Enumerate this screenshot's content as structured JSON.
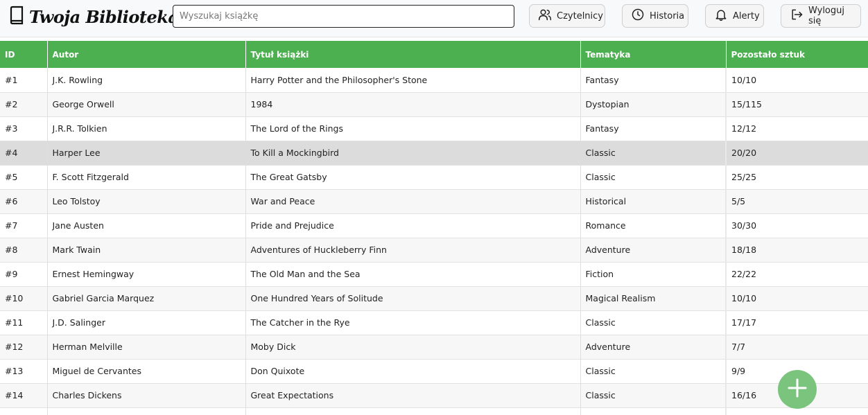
{
  "header": {
    "logo_text": "Twoja Biblioteka",
    "search_placeholder": "Wyszukaj książkę",
    "buttons": {
      "readers": "Czytelnicy",
      "history": "Historia",
      "alerts": "Alerty",
      "logout": "Wyloguj się"
    }
  },
  "table": {
    "headers": [
      "ID",
      "Autor",
      "Tytuł książki",
      "Tematyka",
      "Pozostało sztuk"
    ],
    "rows": [
      [
        "#1",
        "J.K. Rowling",
        "Harry Potter and the Philosopher's Stone",
        "Fantasy",
        "10/10"
      ],
      [
        "#2",
        "George Orwell",
        "1984",
        "Dystopian",
        "15/115"
      ],
      [
        "#3",
        "J.R.R. Tolkien",
        "The Lord of the Rings",
        "Fantasy",
        "12/12"
      ],
      [
        "#4",
        "Harper Lee",
        "To Kill a Mockingbird",
        "Classic",
        "20/20"
      ],
      [
        "#5",
        "F. Scott Fitzgerald",
        "The Great Gatsby",
        "Classic",
        "25/25"
      ],
      [
        "#6",
        "Leo Tolstoy",
        "War and Peace",
        "Historical",
        "5/5"
      ],
      [
        "#7",
        "Jane Austen",
        "Pride and Prejudice",
        "Romance",
        "30/30"
      ],
      [
        "#8",
        "Mark Twain",
        "Adventures of Huckleberry Finn",
        "Adventure",
        "18/18"
      ],
      [
        "#9",
        "Ernest Hemingway",
        "The Old Man and the Sea",
        "Fiction",
        "22/22"
      ],
      [
        "#10",
        "Gabriel Garcia Marquez",
        "One Hundred Years of Solitude",
        "Magical Realism",
        "10/10"
      ],
      [
        "#11",
        "J.D. Salinger",
        "The Catcher in the Rye",
        "Classic",
        "17/17"
      ],
      [
        "#12",
        "Herman Melville",
        "Moby Dick",
        "Adventure",
        "7/7"
      ],
      [
        "#13",
        "Miguel de Cervantes",
        "Don Quixote",
        "Classic",
        "9/9"
      ],
      [
        "#14",
        "Charles Dickens",
        "Great Expectations",
        "Classic",
        "16/16"
      ],
      [
        "",
        "",
        "",
        "",
        ""
      ]
    ],
    "highlighted_row": 3
  },
  "icons": {
    "logo": "book-icon",
    "readers": "users-icon",
    "history": "clock-icon",
    "alerts": "bell-icon",
    "logout": "logout-icon",
    "fab": "plus-icon"
  },
  "colors": {
    "header_green": "#4caf50",
    "fab_green": "#7bc47e",
    "highlight_row": "#dcdcdc"
  }
}
